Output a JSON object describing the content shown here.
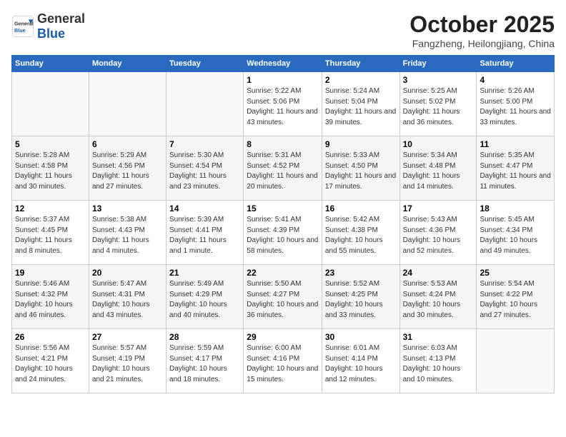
{
  "header": {
    "logo_general": "General",
    "logo_blue": "Blue",
    "month": "October 2025",
    "location": "Fangzheng, Heilongjiang, China"
  },
  "weekdays": [
    "Sunday",
    "Monday",
    "Tuesday",
    "Wednesday",
    "Thursday",
    "Friday",
    "Saturday"
  ],
  "weeks": [
    [
      {
        "day": "",
        "info": ""
      },
      {
        "day": "",
        "info": ""
      },
      {
        "day": "",
        "info": ""
      },
      {
        "day": "1",
        "info": "Sunrise: 5:22 AM\nSunset: 5:06 PM\nDaylight: 11 hours and 43 minutes."
      },
      {
        "day": "2",
        "info": "Sunrise: 5:24 AM\nSunset: 5:04 PM\nDaylight: 11 hours and 39 minutes."
      },
      {
        "day": "3",
        "info": "Sunrise: 5:25 AM\nSunset: 5:02 PM\nDaylight: 11 hours and 36 minutes."
      },
      {
        "day": "4",
        "info": "Sunrise: 5:26 AM\nSunset: 5:00 PM\nDaylight: 11 hours and 33 minutes."
      }
    ],
    [
      {
        "day": "5",
        "info": "Sunrise: 5:28 AM\nSunset: 4:58 PM\nDaylight: 11 hours and 30 minutes."
      },
      {
        "day": "6",
        "info": "Sunrise: 5:29 AM\nSunset: 4:56 PM\nDaylight: 11 hours and 27 minutes."
      },
      {
        "day": "7",
        "info": "Sunrise: 5:30 AM\nSunset: 4:54 PM\nDaylight: 11 hours and 23 minutes."
      },
      {
        "day": "8",
        "info": "Sunrise: 5:31 AM\nSunset: 4:52 PM\nDaylight: 11 hours and 20 minutes."
      },
      {
        "day": "9",
        "info": "Sunrise: 5:33 AM\nSunset: 4:50 PM\nDaylight: 11 hours and 17 minutes."
      },
      {
        "day": "10",
        "info": "Sunrise: 5:34 AM\nSunset: 4:48 PM\nDaylight: 11 hours and 14 minutes."
      },
      {
        "day": "11",
        "info": "Sunrise: 5:35 AM\nSunset: 4:47 PM\nDaylight: 11 hours and 11 minutes."
      }
    ],
    [
      {
        "day": "12",
        "info": "Sunrise: 5:37 AM\nSunset: 4:45 PM\nDaylight: 11 hours and 8 minutes."
      },
      {
        "day": "13",
        "info": "Sunrise: 5:38 AM\nSunset: 4:43 PM\nDaylight: 11 hours and 4 minutes."
      },
      {
        "day": "14",
        "info": "Sunrise: 5:39 AM\nSunset: 4:41 PM\nDaylight: 11 hours and 1 minute."
      },
      {
        "day": "15",
        "info": "Sunrise: 5:41 AM\nSunset: 4:39 PM\nDaylight: 10 hours and 58 minutes."
      },
      {
        "day": "16",
        "info": "Sunrise: 5:42 AM\nSunset: 4:38 PM\nDaylight: 10 hours and 55 minutes."
      },
      {
        "day": "17",
        "info": "Sunrise: 5:43 AM\nSunset: 4:36 PM\nDaylight: 10 hours and 52 minutes."
      },
      {
        "day": "18",
        "info": "Sunrise: 5:45 AM\nSunset: 4:34 PM\nDaylight: 10 hours and 49 minutes."
      }
    ],
    [
      {
        "day": "19",
        "info": "Sunrise: 5:46 AM\nSunset: 4:32 PM\nDaylight: 10 hours and 46 minutes."
      },
      {
        "day": "20",
        "info": "Sunrise: 5:47 AM\nSunset: 4:31 PM\nDaylight: 10 hours and 43 minutes."
      },
      {
        "day": "21",
        "info": "Sunrise: 5:49 AM\nSunset: 4:29 PM\nDaylight: 10 hours and 40 minutes."
      },
      {
        "day": "22",
        "info": "Sunrise: 5:50 AM\nSunset: 4:27 PM\nDaylight: 10 hours and 36 minutes."
      },
      {
        "day": "23",
        "info": "Sunrise: 5:52 AM\nSunset: 4:25 PM\nDaylight: 10 hours and 33 minutes."
      },
      {
        "day": "24",
        "info": "Sunrise: 5:53 AM\nSunset: 4:24 PM\nDaylight: 10 hours and 30 minutes."
      },
      {
        "day": "25",
        "info": "Sunrise: 5:54 AM\nSunset: 4:22 PM\nDaylight: 10 hours and 27 minutes."
      }
    ],
    [
      {
        "day": "26",
        "info": "Sunrise: 5:56 AM\nSunset: 4:21 PM\nDaylight: 10 hours and 24 minutes."
      },
      {
        "day": "27",
        "info": "Sunrise: 5:57 AM\nSunset: 4:19 PM\nDaylight: 10 hours and 21 minutes."
      },
      {
        "day": "28",
        "info": "Sunrise: 5:59 AM\nSunset: 4:17 PM\nDaylight: 10 hours and 18 minutes."
      },
      {
        "day": "29",
        "info": "Sunrise: 6:00 AM\nSunset: 4:16 PM\nDaylight: 10 hours and 15 minutes."
      },
      {
        "day": "30",
        "info": "Sunrise: 6:01 AM\nSunset: 4:14 PM\nDaylight: 10 hours and 12 minutes."
      },
      {
        "day": "31",
        "info": "Sunrise: 6:03 AM\nSunset: 4:13 PM\nDaylight: 10 hours and 10 minutes."
      },
      {
        "day": "",
        "info": ""
      }
    ]
  ]
}
